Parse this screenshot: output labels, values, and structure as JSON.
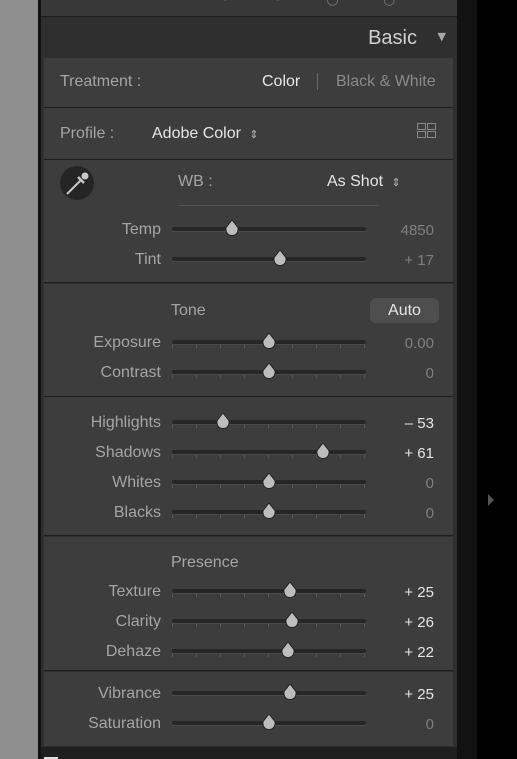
{
  "header": {
    "title": "Basic"
  },
  "treatment": {
    "label": "Treatment :",
    "color": "Color",
    "bw": "Black & White"
  },
  "profile": {
    "label": "Profile :",
    "value": "Adobe Color",
    "arrows": "⇕"
  },
  "wb": {
    "label": "WB :",
    "value": "As Shot",
    "arrows": "⇕"
  },
  "tone": {
    "label": "Tone",
    "auto": "Auto"
  },
  "presence": {
    "label": "Presence"
  },
  "sliders": {
    "temp": {
      "label": "Temp",
      "value": "4850",
      "level": 0.31
    },
    "tint": {
      "label": "Tint",
      "value": "+ 17",
      "level": 0.555
    },
    "exposure": {
      "label": "Exposure",
      "value": "0.00",
      "level": 0.5
    },
    "contrast": {
      "label": "Contrast",
      "value": "0",
      "level": 0.5
    },
    "highlights": {
      "label": "Highlights",
      "value": "– 53",
      "level": 0.265
    },
    "shadows": {
      "label": "Shadows",
      "value": "+ 61",
      "level": 0.78
    },
    "whites": {
      "label": "Whites",
      "value": "0",
      "level": 0.5
    },
    "blacks": {
      "label": "Blacks",
      "value": "0",
      "level": 0.5
    },
    "texture": {
      "label": "Texture",
      "value": "+ 25",
      "level": 0.61
    },
    "clarity": {
      "label": "Clarity",
      "value": "+ 26",
      "level": 0.62
    },
    "dehaze": {
      "label": "Dehaze",
      "value": "+ 22",
      "level": 0.6
    },
    "vibrance": {
      "label": "Vibrance",
      "value": "+ 25",
      "level": 0.61
    },
    "saturation": {
      "label": "Saturation",
      "value": "0",
      "level": 0.5
    }
  },
  "colors": {
    "panel": "#3d3d3d",
    "background": "#2f2f2f",
    "text": "#a5a5a5",
    "value_active": "#e6e6e6"
  },
  "icons": [
    "eyedropper-icon",
    "grid-view-icon",
    "collapse-triangle-icon",
    "panel-expand-arrow-icon"
  ]
}
